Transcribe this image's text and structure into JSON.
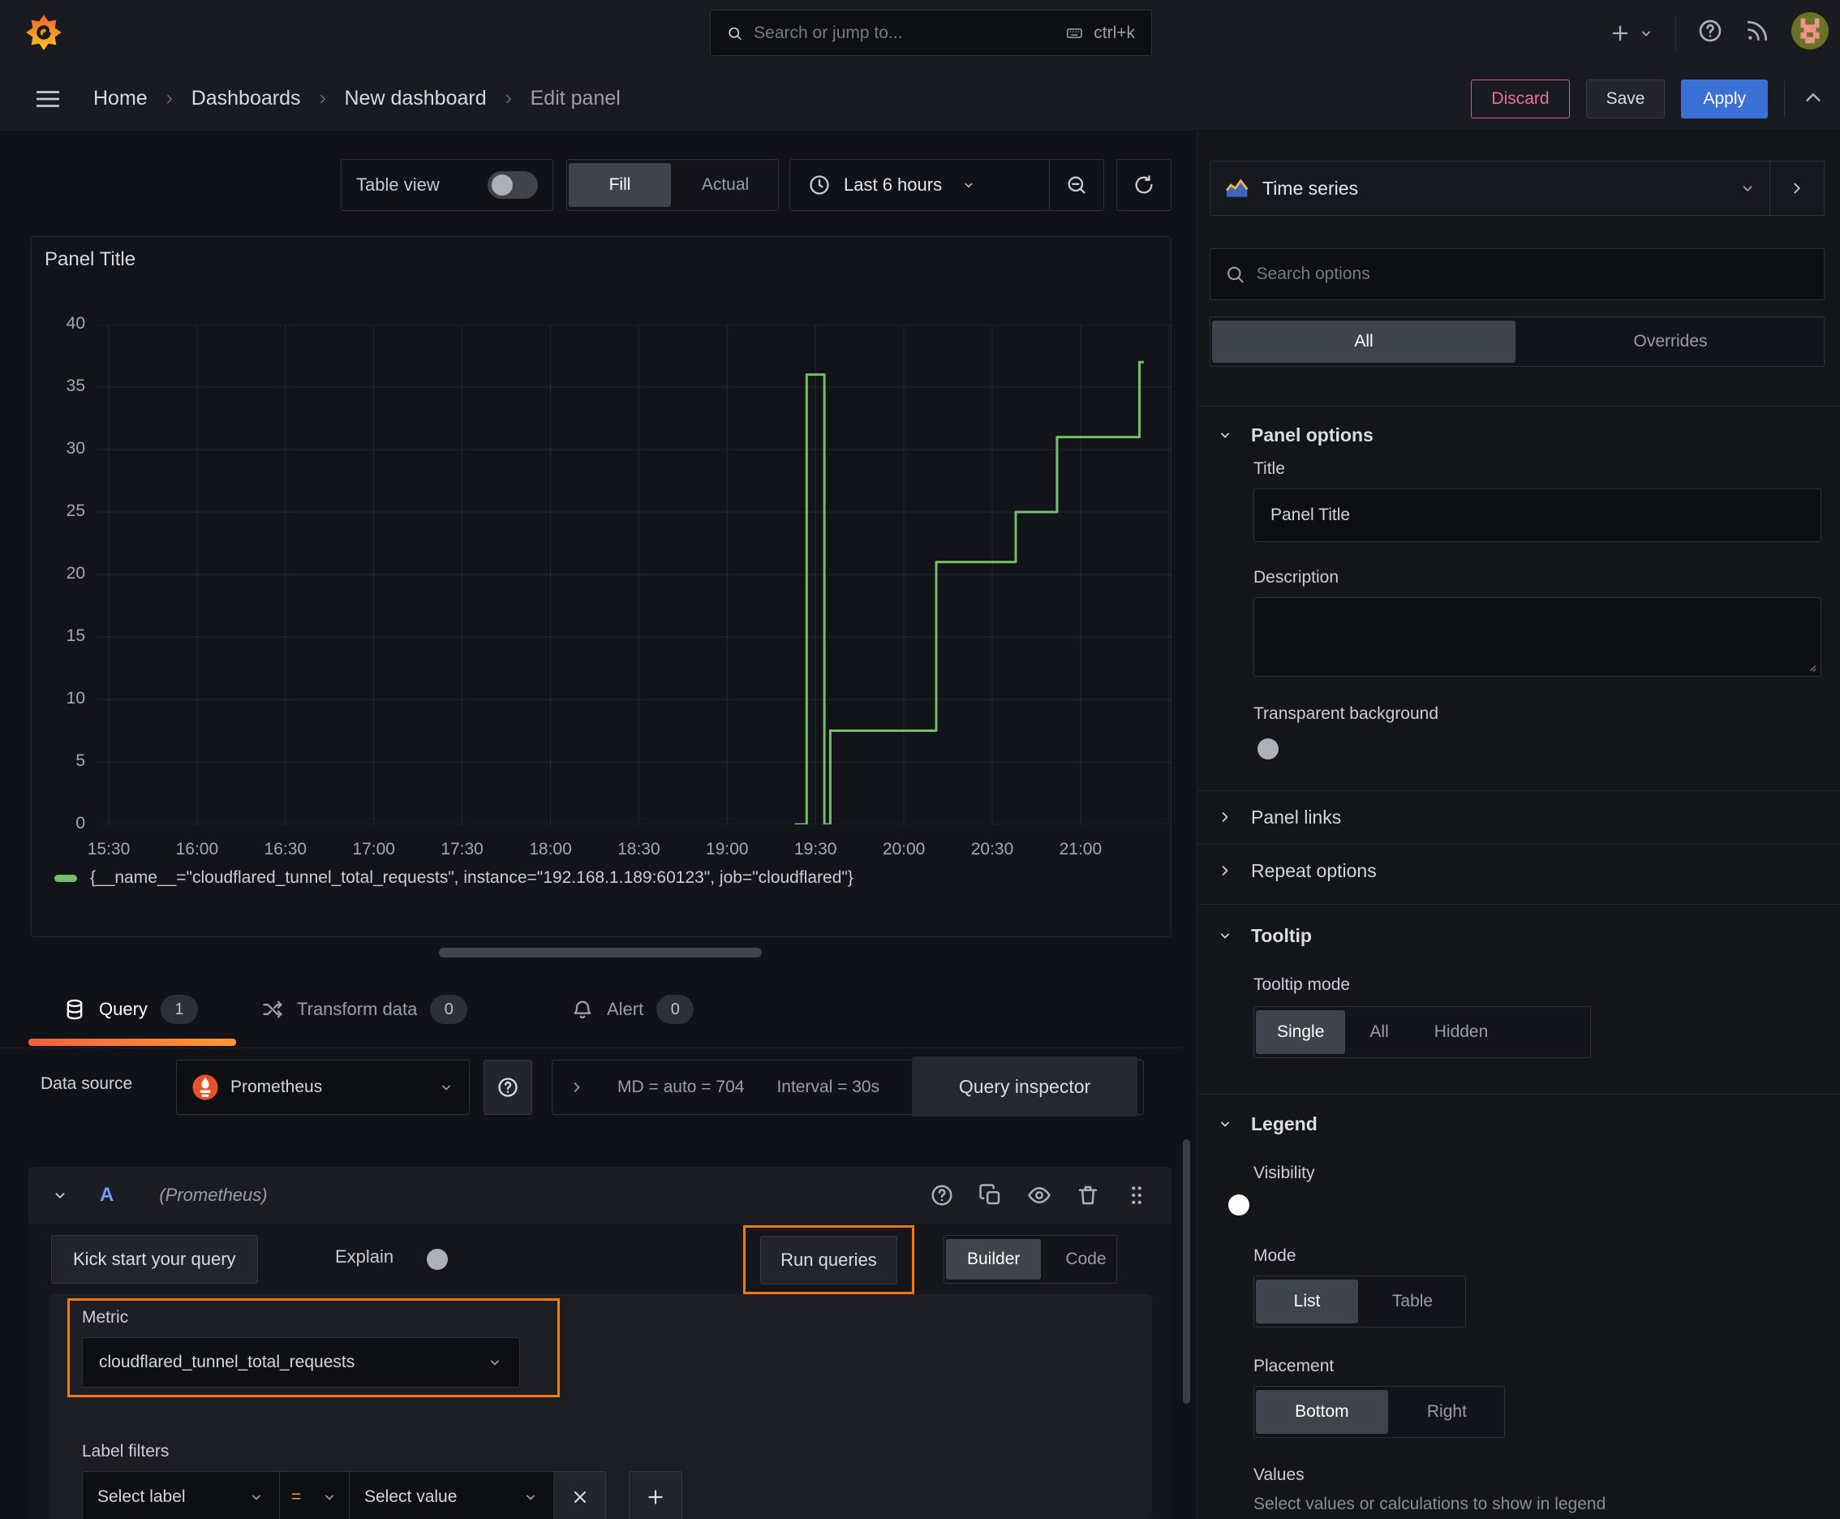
{
  "colors": {
    "accent_blue": "#3D71D9",
    "accent_orange": "#FF780A",
    "series_green": "#73BF69",
    "discard_pink": "#E0568C"
  },
  "topbar": {
    "search_placeholder": "Search or jump to...",
    "search_shortcut": "ctrl+k"
  },
  "breadcrumb": {
    "items": [
      "Home",
      "Dashboards",
      "New dashboard",
      "Edit panel"
    ],
    "discard_label": "Discard",
    "save_label": "Save",
    "apply_label": "Apply"
  },
  "toolbar": {
    "table_view_label": "Table view",
    "fill_label": "Fill",
    "actual_label": "Actual",
    "time_range_label": "Last 6 hours"
  },
  "panel": {
    "title": "Panel Title",
    "legend_label": "{__name__=\"cloudflared_tunnel_total_requests\", instance=\"192.168.1.189:60123\", job=\"cloudflared\"}"
  },
  "chart_data": {
    "type": "line",
    "title": "Panel Title",
    "xlabel": "",
    "ylabel": "",
    "ylim": [
      0,
      40
    ],
    "grid": true,
    "legend_position": "bottom",
    "x_ticks": [
      "15:30",
      "16:00",
      "16:30",
      "17:00",
      "17:30",
      "18:00",
      "18:30",
      "19:00",
      "19:30",
      "20:00",
      "20:30",
      "21:00"
    ],
    "x_tick_interval_min": 30,
    "y_ticks": [
      0,
      5,
      10,
      15,
      20,
      25,
      30,
      35,
      40
    ],
    "series": [
      {
        "name": "{__name__=\"cloudflared_tunnel_total_requests\", instance=\"192.168.1.189:60123\", job=\"cloudflared\"}",
        "color": "#73BF69",
        "points_time_min_from_1530": [
          [
            233,
            0
          ],
          [
            237,
            0
          ],
          [
            237,
            36
          ],
          [
            243,
            36
          ],
          [
            243,
            0
          ],
          [
            245,
            0
          ],
          [
            245,
            7.5
          ],
          [
            281,
            7.5
          ],
          [
            281,
            21
          ],
          [
            308,
            21
          ],
          [
            308,
            25
          ],
          [
            322,
            25
          ],
          [
            322,
            31
          ],
          [
            350,
            31
          ],
          [
            350,
            37
          ],
          [
            351.5,
            37
          ]
        ]
      }
    ]
  },
  "query_section": {
    "tabs": [
      {
        "label": "Query",
        "count": "1"
      },
      {
        "label": "Transform data",
        "count": "0"
      },
      {
        "label": "Alert",
        "count": "0"
      }
    ],
    "datasource": {
      "label": "Data source",
      "name": "Prometheus",
      "stats_md": "MD = auto = 704",
      "stats_interval": "Interval = 30s",
      "inspector_label": "Query inspector"
    },
    "query_row": {
      "ref_id": "A",
      "datasource_hint": "(Prometheus)"
    },
    "editor_toolbar": {
      "kickstart_label": "Kick start your query",
      "explain_label": "Explain",
      "run_label": "Run queries",
      "builder_label": "Builder",
      "code_label": "Code"
    },
    "metric": {
      "label": "Metric",
      "value": "cloudflared_tunnel_total_requests"
    },
    "label_filters": {
      "label": "Label filters",
      "select_label_placeholder": "Select label",
      "operator": "=",
      "select_value_placeholder": "Select value"
    }
  },
  "sidebar": {
    "viz_picker_label": "Time series",
    "search_placeholder": "Search options",
    "filter_tabs": {
      "all": "All",
      "overrides": "Overrides"
    },
    "panel_options": {
      "header": "Panel options",
      "title_label": "Title",
      "title_value": "Panel Title",
      "description_label": "Description",
      "transparent_label": "Transparent background"
    },
    "panel_links_header": "Panel links",
    "repeat_options_header": "Repeat options",
    "tooltip": {
      "header": "Tooltip",
      "mode_label": "Tooltip mode",
      "options": [
        "Single",
        "All",
        "Hidden"
      ],
      "selected": "Single"
    },
    "legend": {
      "header": "Legend",
      "visibility_label": "Visibility",
      "mode_label": "Mode",
      "mode_options": [
        "List",
        "Table"
      ],
      "placement_label": "Placement",
      "placement_options": [
        "Bottom",
        "Right"
      ],
      "values_label": "Values",
      "values_help": "Select values or calculations to show in legend"
    }
  }
}
